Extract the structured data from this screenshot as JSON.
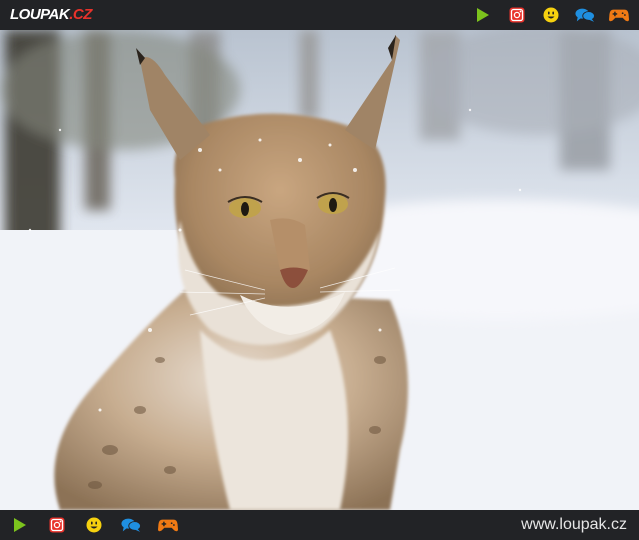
{
  "header": {
    "logo_main": "LOUPAK",
    "logo_tld": ".CZ",
    "icons": [
      "play-icon",
      "instagram-icon",
      "smiley-icon",
      "chat-icon",
      "gamepad-icon"
    ]
  },
  "footer": {
    "icons": [
      "play-icon",
      "instagram-icon",
      "smiley-icon",
      "chat-icon",
      "gamepad-icon"
    ],
    "site_url": "www.loupak.cz"
  },
  "colors": {
    "bar_bg": "#222326",
    "play": "#7cc31d",
    "instagram": "#e8322b",
    "smiley": "#f6d10f",
    "chat": "#1f8fe0",
    "gamepad": "#f07a14"
  }
}
